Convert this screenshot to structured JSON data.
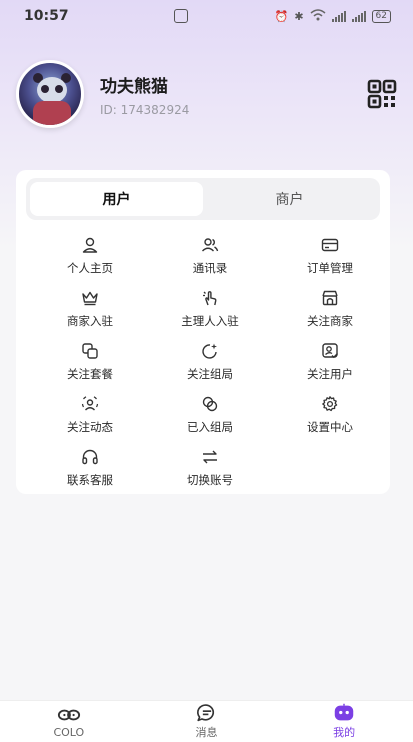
{
  "status_bar": {
    "time": "10:57",
    "battery": "62"
  },
  "profile": {
    "name": "功夫熊猫",
    "id": "ID: 174382924"
  },
  "tabs": [
    {
      "label": "用户",
      "active": true
    },
    {
      "label": "商户",
      "active": false
    }
  ],
  "menu": [
    {
      "label": "个人主页",
      "icon": "person-icon"
    },
    {
      "label": "通讯录",
      "icon": "contacts-icon"
    },
    {
      "label": "订单管理",
      "icon": "card-icon"
    },
    {
      "label": "商家入驻",
      "icon": "crown-icon"
    },
    {
      "label": "主理人入驻",
      "icon": "tap-hand-icon"
    },
    {
      "label": "关注商家",
      "icon": "store-icon"
    },
    {
      "label": "关注套餐",
      "icon": "package-icon"
    },
    {
      "label": "关注组局",
      "icon": "sparkle-icon"
    },
    {
      "label": "关注用户",
      "icon": "user-check-icon"
    },
    {
      "label": "关注动态",
      "icon": "activity-icon"
    },
    {
      "label": "已入组局",
      "icon": "link-icon"
    },
    {
      "label": "设置中心",
      "icon": "gear-icon"
    },
    {
      "label": "联系客服",
      "icon": "headset-icon"
    },
    {
      "label": "切换账号",
      "icon": "switch-icon"
    }
  ],
  "bottom_nav": [
    {
      "label": "COLO",
      "icon": "infinity-icon",
      "active": false
    },
    {
      "label": "消息",
      "icon": "chat-icon",
      "active": false
    },
    {
      "label": "我的",
      "icon": "robot-face-icon",
      "active": true
    }
  ],
  "colors": {
    "accent": "#7b3fe4",
    "header_gradient_top": "#e2d9f6"
  }
}
